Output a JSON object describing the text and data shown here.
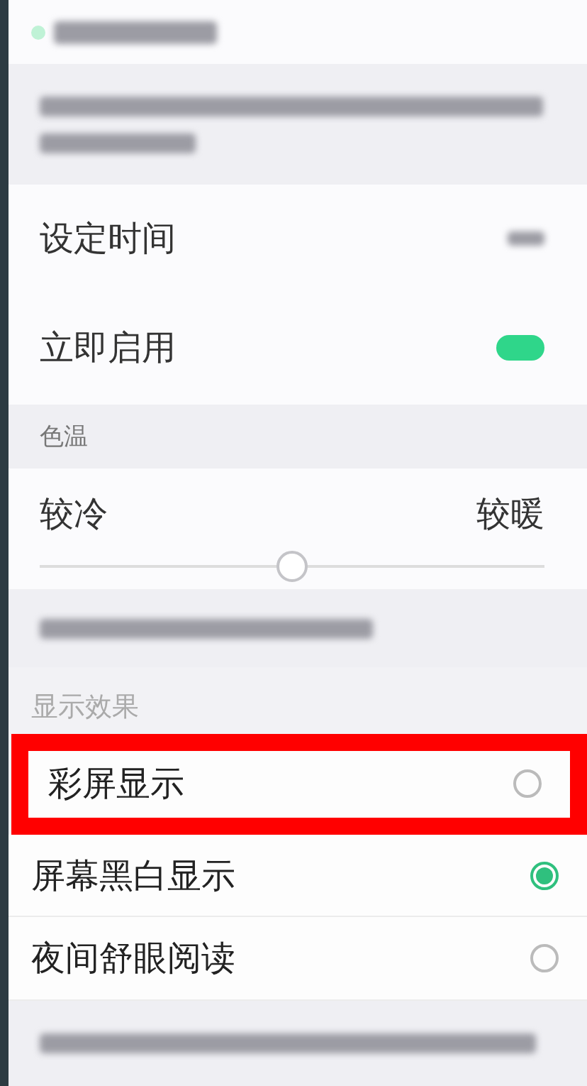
{
  "rows": [
    {
      "kind": "setting",
      "label": "设定时间"
    },
    {
      "kind": "toggle",
      "label": "立即启用",
      "on": true
    }
  ],
  "color_temp": {
    "header": "色温",
    "cold": "较冷",
    "warm": "较暖",
    "level": 0.5
  },
  "display": {
    "header": "显示效果",
    "options": [
      {
        "label": "彩屏显示",
        "selected": false,
        "highlighted": true
      },
      {
        "label": "屏幕黑白显示",
        "selected": true,
        "highlighted": false
      },
      {
        "label": "夜间舒眼阅读",
        "selected": false,
        "highlighted": false
      }
    ]
  }
}
